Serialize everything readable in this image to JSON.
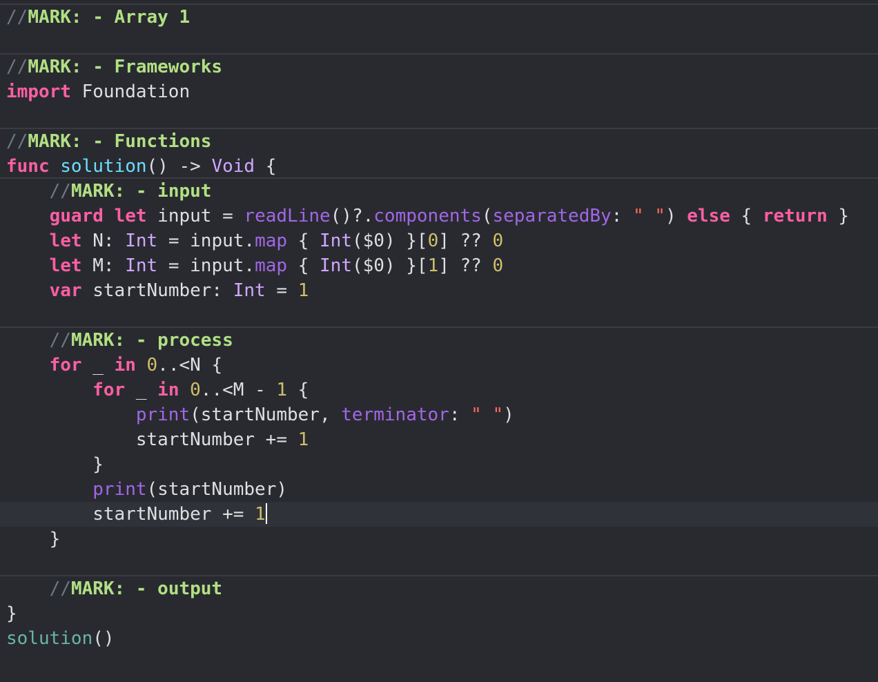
{
  "editor": {
    "language": "Swift",
    "theme_colors": {
      "background": "#292a30",
      "current_line": "#2f3239",
      "plain": "#dfdfe0",
      "keyword": "#fc5fa3",
      "type": "#d0a8ff",
      "function": "#a167e6",
      "number": "#d0bf69",
      "string": "#fc6a5d",
      "mark": "#b1e083",
      "call": "#67b7a4"
    },
    "cursor_line_index": 20,
    "lines": [
      {
        "tokens": [
          {
            "c": "comment",
            "t": "//"
          },
          {
            "c": "mark-green",
            "t": "MARK: - Array 1"
          }
        ]
      },
      {
        "tokens": []
      },
      {
        "tokens": [
          {
            "c": "comment",
            "t": "//"
          },
          {
            "c": "mark-green",
            "t": "MARK: - Frameworks"
          }
        ]
      },
      {
        "tokens": [
          {
            "c": "keyword",
            "t": "import"
          },
          {
            "c": "plain",
            "t": " Foundation"
          }
        ]
      },
      {
        "tokens": []
      },
      {
        "tokens": [
          {
            "c": "comment",
            "t": "//"
          },
          {
            "c": "mark-green",
            "t": "MARK: - Functions"
          }
        ]
      },
      {
        "tokens": [
          {
            "c": "keyword",
            "t": "func"
          },
          {
            "c": "plain",
            "t": " "
          },
          {
            "c": "decl",
            "t": "solution"
          },
          {
            "c": "plain",
            "t": "() -> "
          },
          {
            "c": "type",
            "t": "Void"
          },
          {
            "c": "plain",
            "t": " {"
          }
        ]
      },
      {
        "tokens": [
          {
            "c": "plain",
            "t": "    "
          },
          {
            "c": "comment",
            "t": "//"
          },
          {
            "c": "mark-green",
            "t": "MARK: - input"
          }
        ]
      },
      {
        "tokens": [
          {
            "c": "plain",
            "t": "    "
          },
          {
            "c": "keyword",
            "t": "guard"
          },
          {
            "c": "plain",
            "t": " "
          },
          {
            "c": "keyword",
            "t": "let"
          },
          {
            "c": "plain",
            "t": " input = "
          },
          {
            "c": "function",
            "t": "readLine"
          },
          {
            "c": "plain",
            "t": "()?."
          },
          {
            "c": "function",
            "t": "components"
          },
          {
            "c": "plain",
            "t": "("
          },
          {
            "c": "function",
            "t": "separatedBy"
          },
          {
            "c": "plain",
            "t": ": "
          },
          {
            "c": "string",
            "t": "\" \""
          },
          {
            "c": "plain",
            "t": ") "
          },
          {
            "c": "keyword",
            "t": "else"
          },
          {
            "c": "plain",
            "t": " { "
          },
          {
            "c": "keyword",
            "t": "return"
          },
          {
            "c": "plain",
            "t": " }"
          }
        ]
      },
      {
        "tokens": [
          {
            "c": "plain",
            "t": "    "
          },
          {
            "c": "keyword",
            "t": "let"
          },
          {
            "c": "plain",
            "t": " N: "
          },
          {
            "c": "type",
            "t": "Int"
          },
          {
            "c": "plain",
            "t": " = input."
          },
          {
            "c": "function",
            "t": "map"
          },
          {
            "c": "plain",
            "t": " { "
          },
          {
            "c": "type",
            "t": "Int"
          },
          {
            "c": "plain",
            "t": "($0) }["
          },
          {
            "c": "number",
            "t": "0"
          },
          {
            "c": "plain",
            "t": "] ?? "
          },
          {
            "c": "number",
            "t": "0"
          }
        ]
      },
      {
        "tokens": [
          {
            "c": "plain",
            "t": "    "
          },
          {
            "c": "keyword",
            "t": "let"
          },
          {
            "c": "plain",
            "t": " M: "
          },
          {
            "c": "type",
            "t": "Int"
          },
          {
            "c": "plain",
            "t": " = input."
          },
          {
            "c": "function",
            "t": "map"
          },
          {
            "c": "plain",
            "t": " { "
          },
          {
            "c": "type",
            "t": "Int"
          },
          {
            "c": "plain",
            "t": "($0) }["
          },
          {
            "c": "number",
            "t": "1"
          },
          {
            "c": "plain",
            "t": "] ?? "
          },
          {
            "c": "number",
            "t": "0"
          }
        ]
      },
      {
        "tokens": [
          {
            "c": "plain",
            "t": "    "
          },
          {
            "c": "keyword",
            "t": "var"
          },
          {
            "c": "plain",
            "t": " startNumber: "
          },
          {
            "c": "type",
            "t": "Int"
          },
          {
            "c": "plain",
            "t": " = "
          },
          {
            "c": "number",
            "t": "1"
          }
        ]
      },
      {
        "tokens": []
      },
      {
        "tokens": [
          {
            "c": "plain",
            "t": "    "
          },
          {
            "c": "comment",
            "t": "//"
          },
          {
            "c": "mark-green",
            "t": "MARK: - process"
          }
        ]
      },
      {
        "tokens": [
          {
            "c": "plain",
            "t": "    "
          },
          {
            "c": "keyword",
            "t": "for"
          },
          {
            "c": "plain",
            "t": " _ "
          },
          {
            "c": "keyword",
            "t": "in"
          },
          {
            "c": "plain",
            "t": " "
          },
          {
            "c": "number",
            "t": "0"
          },
          {
            "c": "plain",
            "t": "..<N {"
          }
        ]
      },
      {
        "tokens": [
          {
            "c": "plain",
            "t": "        "
          },
          {
            "c": "keyword",
            "t": "for"
          },
          {
            "c": "plain",
            "t": " _ "
          },
          {
            "c": "keyword",
            "t": "in"
          },
          {
            "c": "plain",
            "t": " "
          },
          {
            "c": "number",
            "t": "0"
          },
          {
            "c": "plain",
            "t": "..<M - "
          },
          {
            "c": "number",
            "t": "1"
          },
          {
            "c": "plain",
            "t": " {"
          }
        ]
      },
      {
        "tokens": [
          {
            "c": "plain",
            "t": "            "
          },
          {
            "c": "function",
            "t": "print"
          },
          {
            "c": "plain",
            "t": "(startNumber, "
          },
          {
            "c": "function",
            "t": "terminator"
          },
          {
            "c": "plain",
            "t": ": "
          },
          {
            "c": "string",
            "t": "\" \""
          },
          {
            "c": "plain",
            "t": ")"
          }
        ]
      },
      {
        "tokens": [
          {
            "c": "plain",
            "t": "            startNumber += "
          },
          {
            "c": "number",
            "t": "1"
          }
        ]
      },
      {
        "tokens": [
          {
            "c": "plain",
            "t": "        }"
          }
        ]
      },
      {
        "tokens": [
          {
            "c": "plain",
            "t": "        "
          },
          {
            "c": "function",
            "t": "print"
          },
          {
            "c": "plain",
            "t": "(startNumber)"
          }
        ]
      },
      {
        "tokens": [
          {
            "c": "plain",
            "t": "        startNumber += "
          },
          {
            "c": "number",
            "t": "1"
          }
        ]
      },
      {
        "tokens": [
          {
            "c": "plain",
            "t": "    }"
          }
        ]
      },
      {
        "tokens": []
      },
      {
        "tokens": [
          {
            "c": "plain",
            "t": "    "
          },
          {
            "c": "comment",
            "t": "//"
          },
          {
            "c": "mark-green",
            "t": "MARK: - output"
          }
        ]
      },
      {
        "tokens": [
          {
            "c": "plain",
            "t": "}"
          }
        ]
      },
      {
        "tokens": [
          {
            "c": "call",
            "t": "solution"
          },
          {
            "c": "plain",
            "t": "()"
          }
        ]
      }
    ]
  }
}
